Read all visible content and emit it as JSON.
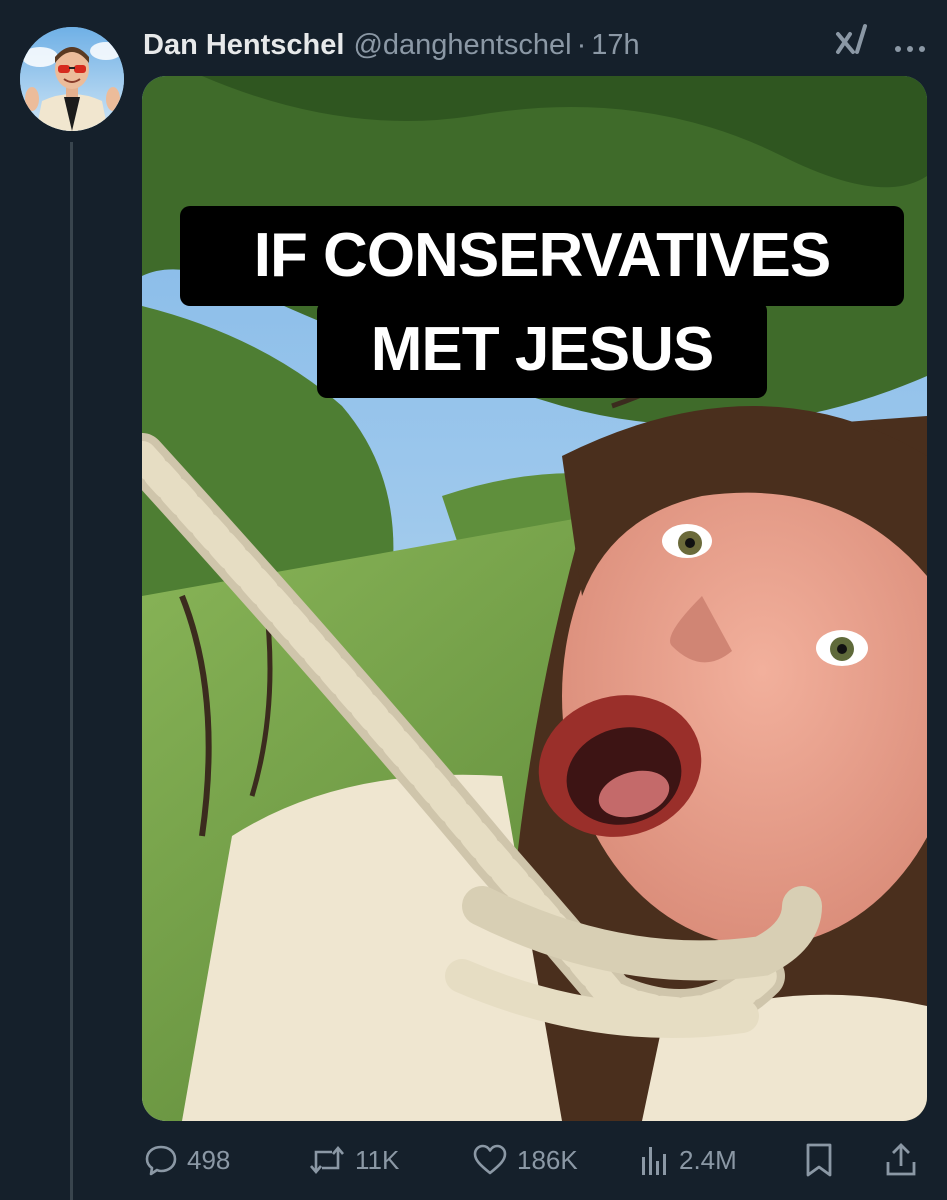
{
  "post": {
    "author": {
      "display_name": "Dan Hentschel",
      "handle": "@danghentschel",
      "avatar_icon": "avatar-photo"
    },
    "separator": "·",
    "timestamp": "17h",
    "grok_icon": "grok-icon",
    "more_icon": "more-icon",
    "media": {
      "caption_line_1": "IF CONSERVATIVES",
      "caption_line_2": "MET JESUS"
    },
    "actions": {
      "replies": "498",
      "reposts": "11K",
      "likes": "186K",
      "views": "2.4M"
    }
  },
  "colors": {
    "background": "#15202b",
    "text_primary": "#e7e9ea",
    "text_secondary": "#8b98a5",
    "thread_line": "#38444d"
  }
}
